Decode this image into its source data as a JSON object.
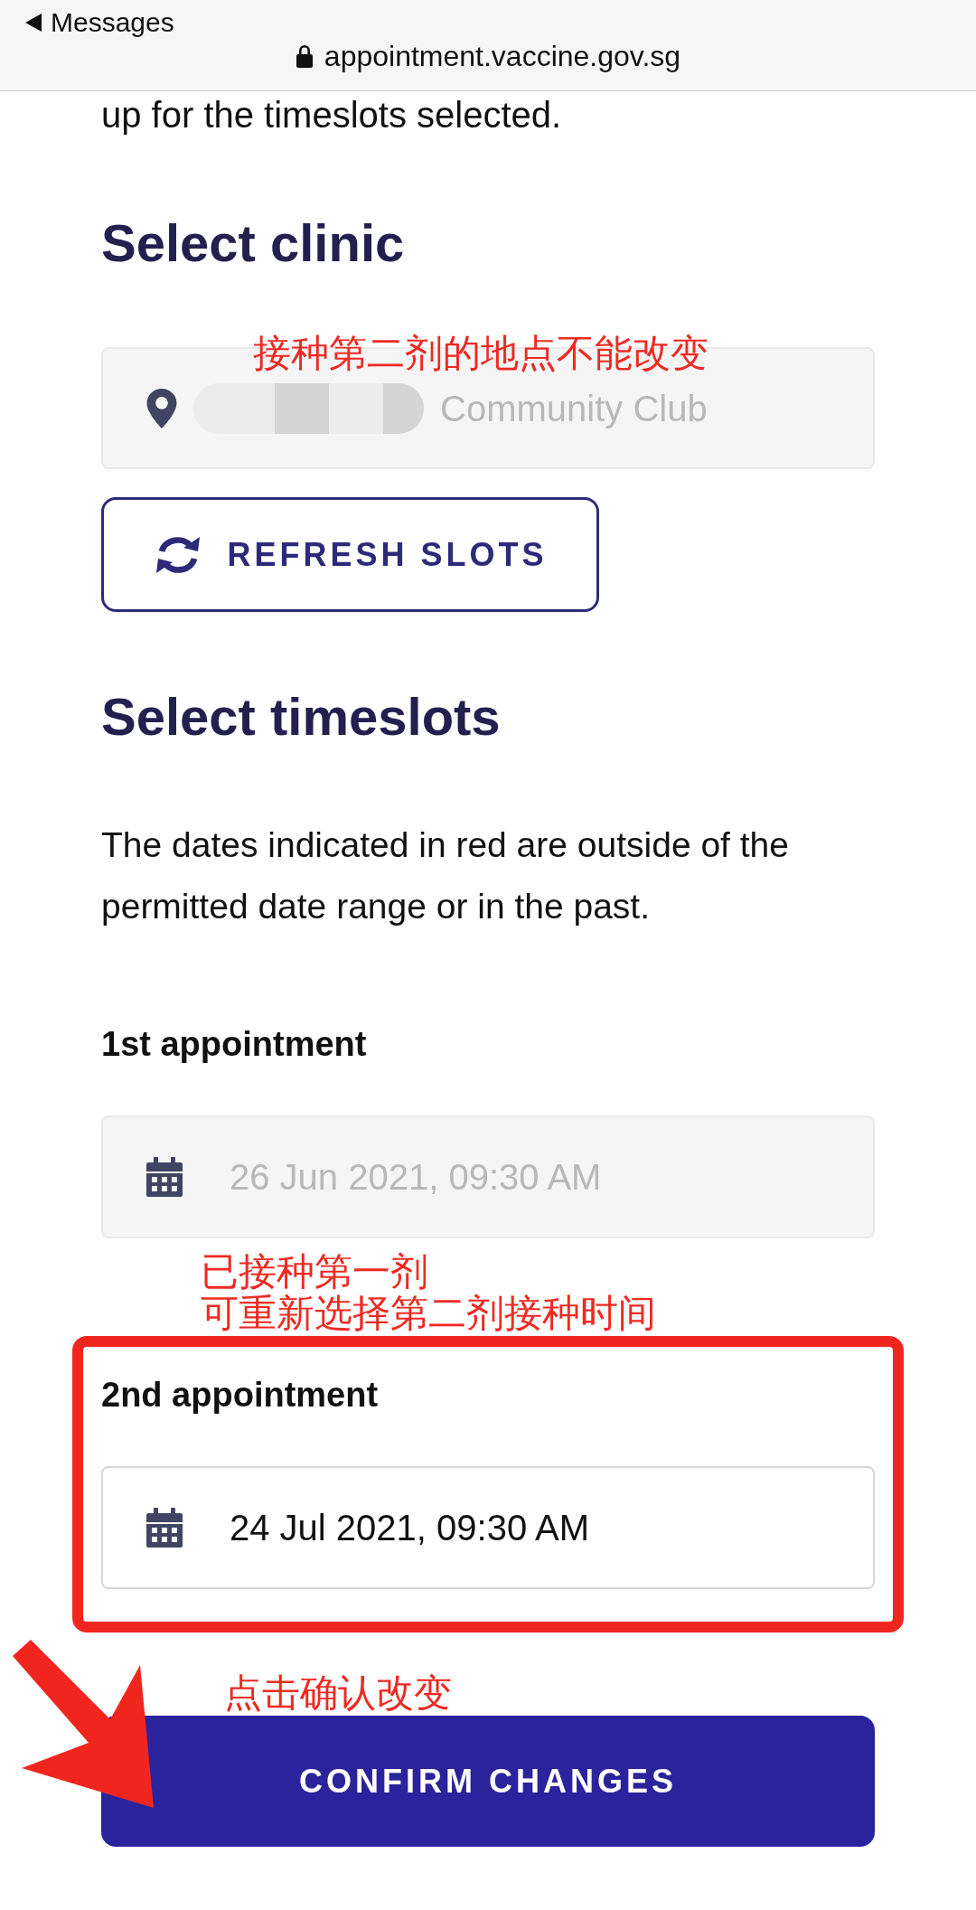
{
  "browser_bar": {
    "back_label": "Messages",
    "url": "appointment.vaccine.gov.sg"
  },
  "intro_tail": "up for the timeslots selected.",
  "clinic": {
    "heading": "Select clinic",
    "value": "Community Club",
    "disabled": true,
    "refresh_button": "REFRESH SLOTS"
  },
  "timeslots": {
    "heading": "Select timeslots",
    "note": "The dates indicated in red are outside of the permitted date range or in the past.",
    "appointments": [
      {
        "label": "1st appointment",
        "value": "26 Jun 2021, 09:30 AM",
        "disabled": true
      },
      {
        "label": "2nd appointment",
        "value": "24 Jul 2021, 09:30 AM",
        "disabled": false
      }
    ]
  },
  "confirm_button": "CONFIRM CHANGES",
  "annotations": [
    {
      "text": "接种第二剂的地点不能改变"
    },
    {
      "text": "已接种第一剂"
    },
    {
      "text": "可重新选择第二剂接种时间"
    },
    {
      "text": "点击确认改变"
    }
  ]
}
